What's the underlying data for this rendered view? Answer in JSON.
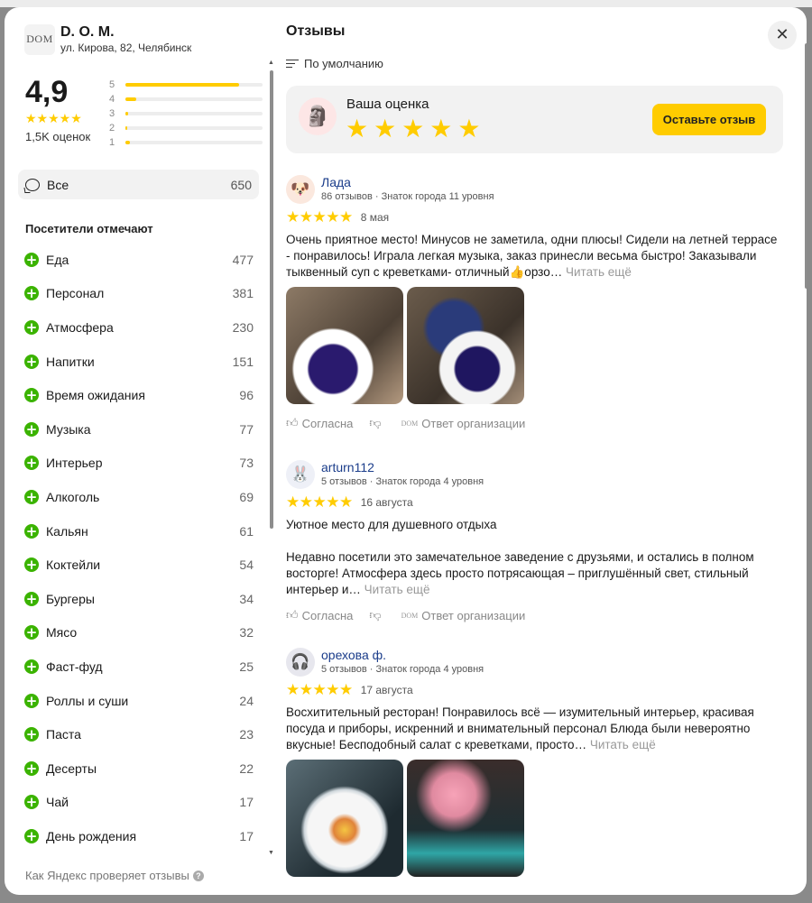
{
  "org": {
    "logo_text": "DOM",
    "name": "D. O. M.",
    "address": "ул. Кирова, 82, Челябинск"
  },
  "rating": {
    "value": "4,9",
    "stars": "★★★★★",
    "count_label": "1,5K оценок",
    "distribution": [
      {
        "stars": "5",
        "fraction": 0.83
      },
      {
        "stars": "4",
        "fraction": 0.08
      },
      {
        "stars": "3",
        "fraction": 0.02
      },
      {
        "stars": "2",
        "fraction": 0.01
      },
      {
        "stars": "1",
        "fraction": 0.03
      }
    ]
  },
  "all_filter": {
    "label": "Все",
    "count": "650"
  },
  "visitors_title": "Посетители отмечают",
  "tags": [
    {
      "label": "Еда",
      "count": "477"
    },
    {
      "label": "Персонал",
      "count": "381"
    },
    {
      "label": "Атмосфера",
      "count": "230"
    },
    {
      "label": "Напитки",
      "count": "151"
    },
    {
      "label": "Время ожидания",
      "count": "96"
    },
    {
      "label": "Музыка",
      "count": "77"
    },
    {
      "label": "Интерьер",
      "count": "73"
    },
    {
      "label": "Алкоголь",
      "count": "69"
    },
    {
      "label": "Кальян",
      "count": "61"
    },
    {
      "label": "Коктейли",
      "count": "54"
    },
    {
      "label": "Бургеры",
      "count": "34"
    },
    {
      "label": "Мясо",
      "count": "32"
    },
    {
      "label": "Фаст-фуд",
      "count": "25"
    },
    {
      "label": "Роллы и суши",
      "count": "24"
    },
    {
      "label": "Паста",
      "count": "23"
    },
    {
      "label": "Десерты",
      "count": "22"
    },
    {
      "label": "Чай",
      "count": "17"
    },
    {
      "label": "День рождения",
      "count": "17"
    }
  ],
  "check_link": "Как Яндекс проверяет отзывы",
  "reviews_title": "Отзывы",
  "close_symbol": "✕",
  "sort_label": "По умолчанию",
  "my_rating": {
    "title": "Ваша оценка",
    "stars": "★★★★★",
    "button": "Оставьте отзыв"
  },
  "reviews": [
    {
      "name": "Лада",
      "meta": "86 отзывов · Знаток города 11 уровня",
      "stars": "★★★★★",
      "date": "8 мая",
      "text": "Очень приятное место! Минусов не заметила, одни плюсы! Сидели на летней террасе - понравилось! Играла легкая музыка, заказ принесли весьма быстро! Заказывали тыквенный суп с креветками- отличный👍орзо…",
      "more": "Читать ещё",
      "agree": "Согласна",
      "org_reply": "Ответ организации"
    },
    {
      "name": "arturn112",
      "meta": "5 отзывов · Знаток города 4 уровня",
      "stars": "★★★★★",
      "date": "16 августа",
      "text_1": "Уютное место для душевного отдыха",
      "text_2": "Недавно посетили это замечательное заведение с друзьями, и остались в полном восторге! Атмосфера здесь просто потрясающая – приглушённый свет, стильный интерьер и…",
      "more": "Читать ещё",
      "agree": "Согласна",
      "org_reply": "Ответ организации"
    },
    {
      "name": "орехова ф.",
      "meta": "5 отзывов · Знаток города 4 уровня",
      "stars": "★★★★★",
      "date": "17 августа",
      "text": "Восхитительный ресторан! Понравилось всё — изумительный интерьер, красивая посуда и приборы, искренний и внимательный персонал Блюда были невероятно вкусные! Бесподобный салат с креветками, просто…",
      "more": "Читать ещё"
    }
  ],
  "colors": {
    "star": "#ffcc00",
    "accent_button": "#ffcc00",
    "tag_plus": "#3bb300",
    "author_link": "#1a3c8a"
  }
}
